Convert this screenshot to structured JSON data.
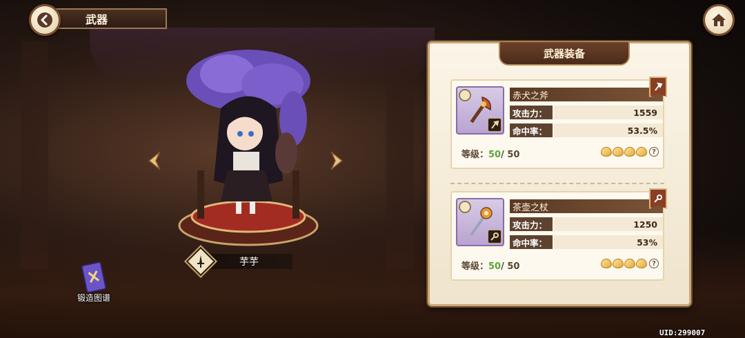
{
  "header": {
    "title": "武器",
    "back_icon": "back-arrow-icon",
    "home_icon": "home-icon"
  },
  "character": {
    "name": "芋芋"
  },
  "forge_book": {
    "label": "锻造图谱"
  },
  "uid": "UID:299007",
  "panel": {
    "title": "武器装备",
    "weapons": [
      {
        "name": "赤犬之斧",
        "type_icon": "axe-icon",
        "attack_label": "攻击力：",
        "attack_value": "1559",
        "hit_label": "命中率：",
        "hit_value": "53.5%",
        "level_label": "等级：",
        "level_current": "50",
        "level_max": "/ 50",
        "stars": 4
      },
      {
        "name": "茶壶之杖",
        "type_icon": "staff-icon",
        "attack_label": "攻击力：",
        "attack_value": "1250",
        "hit_label": "命中率：",
        "hit_value": "53%",
        "level_label": "等级：",
        "level_current": "50",
        "level_max": "/ 50",
        "stars": 4
      }
    ],
    "help_glyph": "?"
  },
  "colors": {
    "panel_bg": "#fbf5e8",
    "accent_brown": "#5e4230",
    "level_green": "#5aa53a",
    "rarity_purple": "#b9a4d1"
  }
}
